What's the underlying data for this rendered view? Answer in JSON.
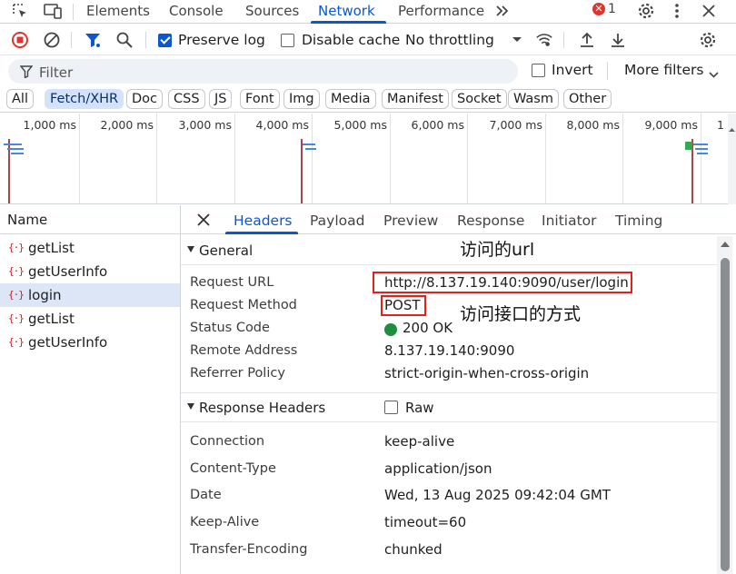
{
  "topbar": {
    "tabs": [
      "Elements",
      "Console",
      "Sources",
      "Network",
      "Performance"
    ],
    "active_tab": "Network",
    "more_tabs_icon": "double-chevron-right-icon",
    "error_count": "1",
    "accent": "#0b57d0"
  },
  "toolbar": {
    "preserve_log_label": "Preserve log",
    "preserve_log_checked": true,
    "disable_cache_label": "Disable cache",
    "disable_cache_checked": false,
    "throttling_value": "No throttling"
  },
  "filter": {
    "placeholder": "Filter",
    "invert_label": "Invert",
    "invert_checked": false,
    "more_filters_label": "More filters"
  },
  "type_filters": [
    {
      "label": "All",
      "active": false
    },
    {
      "label": "Fetch/XHR",
      "active": true
    },
    {
      "label": "Doc",
      "active": false
    },
    {
      "label": "CSS",
      "active": false
    },
    {
      "label": "JS",
      "active": false
    },
    {
      "label": "Font",
      "active": false
    },
    {
      "label": "Img",
      "active": false
    },
    {
      "label": "Media",
      "active": false
    },
    {
      "label": "Manifest",
      "active": false
    },
    {
      "label": "Socket",
      "active": false
    },
    {
      "label": "Wasm",
      "active": false
    },
    {
      "label": "Other",
      "active": false
    }
  ],
  "overview": {
    "ticks": [
      "1,000 ms",
      "2,000 ms",
      "3,000 ms",
      "4,000 ms",
      "5,000 ms",
      "6,000 ms",
      "7,000 ms",
      "8,000 ms",
      "9,000 ms",
      "1"
    ]
  },
  "requests": {
    "header": "Name",
    "items": [
      {
        "name": "getList",
        "selected": false
      },
      {
        "name": "getUserInfo",
        "selected": false
      },
      {
        "name": "login",
        "selected": true
      },
      {
        "name": "getList",
        "selected": false
      },
      {
        "name": "getUserInfo",
        "selected": false
      }
    ]
  },
  "detail": {
    "tabs": [
      "Headers",
      "Payload",
      "Preview",
      "Response",
      "Initiator",
      "Timing"
    ],
    "active_tab": "Headers",
    "general": {
      "title": "General",
      "rows": [
        {
          "key": "Request URL",
          "value": "http://8.137.19.140:9090/user/login"
        },
        {
          "key": "Request Method",
          "value": "POST"
        },
        {
          "key": "Status Code",
          "value": "200 OK"
        },
        {
          "key": "Remote Address",
          "value": "8.137.19.140:9090"
        },
        {
          "key": "Referrer Policy",
          "value": "strict-origin-when-cross-origin"
        }
      ]
    },
    "response_headers": {
      "title": "Response Headers",
      "raw_label": "Raw",
      "raw_checked": false,
      "rows": [
        {
          "key": "Connection",
          "value": "keep-alive"
        },
        {
          "key": "Content-Type",
          "value": "application/json"
        },
        {
          "key": "Date",
          "value": "Wed, 13 Aug 2025 09:42:04 GMT"
        },
        {
          "key": "Keep-Alive",
          "value": "timeout=60"
        },
        {
          "key": "Transfer-Encoding",
          "value": "chunked"
        }
      ]
    }
  },
  "annotations": {
    "url_note": "访问的url",
    "method_note": "访问接口的方式",
    "highlight_color": "#e0221a"
  }
}
